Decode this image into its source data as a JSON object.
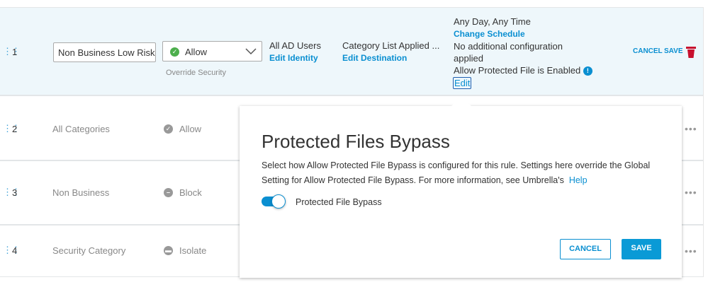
{
  "rows": [
    {
      "num": "1",
      "name": "Non Business Low Risk",
      "action": "Allow",
      "action_note": "Override Security",
      "identity": "All AD Users",
      "identity_link": "Edit Identity",
      "destination": "Category List Applied ...",
      "destination_link": "Edit Destination",
      "schedule": "Any Day, Any Time",
      "schedule_link": "Change Schedule",
      "config": "No additional configuration applied",
      "protected": "Allow Protected File is Enabled",
      "edit": "Edit",
      "cancel": "CANCEL",
      "save": "SAVE"
    },
    {
      "num": "2",
      "name": "All Categories",
      "action": "Allow"
    },
    {
      "num": "3",
      "name": "Non Business",
      "action": "Block"
    },
    {
      "num": "4",
      "name": "Security Category",
      "action": "Isolate"
    }
  ],
  "popover": {
    "title": "Protected Files Bypass",
    "description": "Select how Allow Protected File Bypass is configured for this rule. Settings here override the Global Setting for Allow Protected File Bypass. For more information, see Umbrella's",
    "help": "Help",
    "toggle_label": "Protected File Bypass",
    "toggle_on": true,
    "cancel": "CANCEL",
    "save": "SAVE"
  },
  "colors": {
    "accent": "#0a8fd1",
    "allow": "#4cae4c",
    "delete": "#c8102e"
  }
}
